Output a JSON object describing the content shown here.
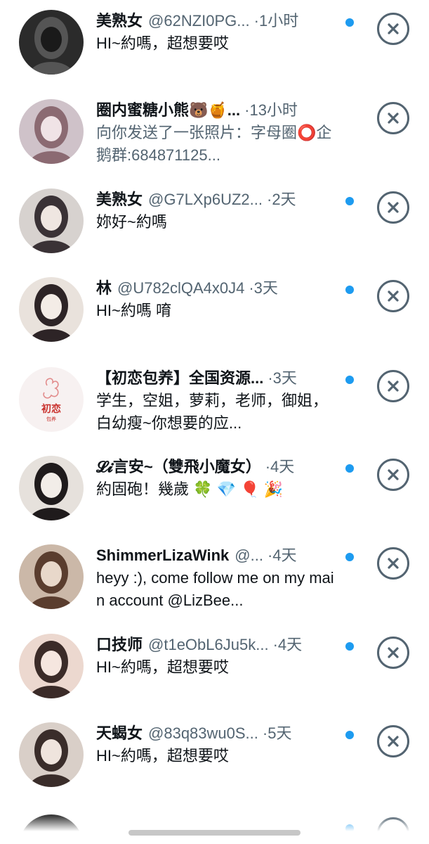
{
  "notifications": [
    {
      "name": "美熟女",
      "handle": "@62NZI0PG...",
      "separator": "·",
      "time": "1小时",
      "message": "HI~約嗎，超想要哎",
      "message_style": "dark",
      "avatar_icon": "avatar-photo",
      "unread": true
    },
    {
      "name": "圈内蜜糖小熊🐻🍯...",
      "handle": "",
      "separator": "·",
      "time": "13小时",
      "message": "向你发送了一张照片：字母圈⭕企鹅群:684871125...",
      "message_style": "gray",
      "avatar_icon": "avatar-photo",
      "unread": false
    },
    {
      "name": "美熟女",
      "handle": "@G7LXp6UZ2...",
      "separator": "·",
      "time": "2天",
      "message": "妳好~約嗎",
      "message_style": "dark",
      "avatar_icon": "avatar-photo",
      "unread": true
    },
    {
      "name": "林",
      "handle": "@U782clQA4x0J4",
      "separator": "·",
      "time": "3天",
      "message": "HI~約嗎 唷",
      "message_style": "dark",
      "avatar_icon": "avatar-photo",
      "unread": true
    },
    {
      "name": "【初恋包养】全国资源...",
      "handle": "",
      "separator": "·",
      "time": "3天",
      "message": "学生，空姐，萝莉，老师，御姐，白幼瘦~你想要的应...",
      "message_style": "dark",
      "avatar_icon": "avatar-logo",
      "avatar_logo_text": "初恋",
      "avatar_logo_sub": "包养",
      "unread": true
    },
    {
      "name": "𝓛𝓲言安~（雙飛小魔女）",
      "handle": "",
      "separator": "·",
      "time": "4天",
      "message": "約固砲！幾歲 🍀 💎 🎈 🎉",
      "message_style": "dark",
      "avatar_icon": "avatar-photo",
      "unread": true
    },
    {
      "name": "ShimmerLizaWink",
      "handle": "@...",
      "separator": "·",
      "time": "4天",
      "message": "heyy :), come follow me on my main account @LizBee...",
      "message_style": "dark",
      "avatar_icon": "avatar-photo",
      "unread": true
    },
    {
      "name": "口技师",
      "handle": "@t1eObL6Ju5k...",
      "separator": "·",
      "time": "4天",
      "message": "HI~約嗎，超想要哎",
      "message_style": "dark",
      "avatar_icon": "avatar-photo",
      "unread": true
    },
    {
      "name": "天蝎女",
      "handle": "@83q83wu0S...",
      "separator": "·",
      "time": "5天",
      "message": "HI~約嗎，超想要哎",
      "message_style": "dark",
      "avatar_icon": "avatar-photo",
      "unread": true
    }
  ],
  "colors": {
    "accent": "#1d9bf0",
    "text_primary": "#0f1419",
    "text_secondary": "#536471"
  },
  "icons": {
    "dismiss": "close-circle-icon",
    "unread": "unread-dot"
  }
}
